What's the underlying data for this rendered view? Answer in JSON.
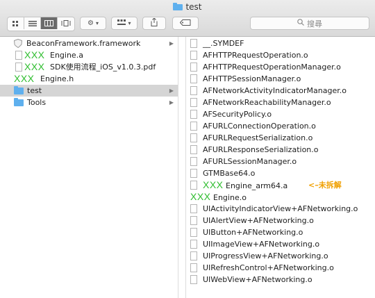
{
  "window": {
    "title": "test"
  },
  "toolbar": {
    "search_placeholder": "搜尋"
  },
  "sidebar_column": {
    "items": [
      {
        "label": "BeaconFramework.framework",
        "type": "framework",
        "has_arrow": true
      },
      {
        "label": "Engine.a",
        "prefix": "XXX",
        "type": "doc",
        "has_arrow": false
      },
      {
        "label": "SDK使用流程_iOS_v1.0.3.pdf",
        "prefix": "XXX",
        "type": "pdf",
        "has_arrow": false
      },
      {
        "label": "Engine.h",
        "prefix": "XXX",
        "type": "doc",
        "has_arrow": false
      },
      {
        "label": "test",
        "type": "folder",
        "has_arrow": true,
        "selected": true
      },
      {
        "label": "Tools",
        "type": "folder",
        "has_arrow": true
      }
    ]
  },
  "files_column": {
    "items": [
      "__.SYMDEF",
      "AFHTTPRequestOperation.o",
      "AFHTTPRequestOperationManager.o",
      "AFHTTPSessionManager.o",
      "AFNetworkActivityIndicatorManager.o",
      "AFNetworkReachabilityManager.o",
      "AFSecurityPolicy.o",
      "AFURLConnectionOperation.o",
      "AFURLRequestSerialization.o",
      "AFURLResponseSerialization.o",
      "AFURLSessionManager.o",
      "GTMBase64.o",
      "XXX Engine_arm64.a",
      "XXX Engine.o",
      "UIActivityIndicatorView+AFNetworking.o",
      "UIAlertView+AFNetworking.o",
      "UIButton+AFNetworking.o",
      "UIImageView+AFNetworking.o",
      "UIProgressView+AFNetworking.o",
      "UIRefreshControl+AFNetworking.o",
      "UIWebView+AFNetworking.o"
    ],
    "annotation": "<–未拆解"
  },
  "colors": {
    "folder": "#5fb0ee",
    "annotation": "#f0a000",
    "xxx": "#2ebd2e",
    "selected": "#d5d5d5"
  }
}
